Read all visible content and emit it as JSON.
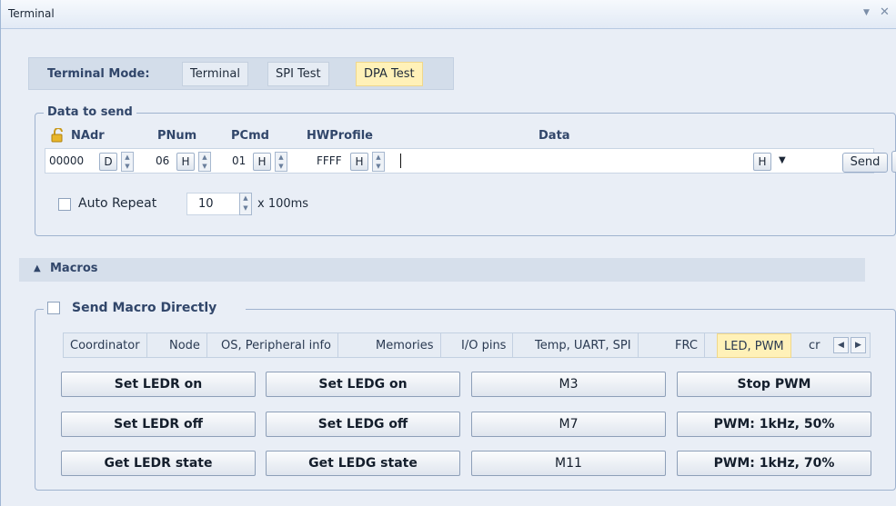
{
  "window": {
    "title": "Terminal",
    "pin_glyph": "▼",
    "close_glyph": "✕"
  },
  "mode": {
    "label": "Terminal Mode:",
    "buttons": [
      {
        "label": "Terminal",
        "active": false
      },
      {
        "label": "SPI Test",
        "active": false
      },
      {
        "label": "DPA Test",
        "active": true
      }
    ]
  },
  "send": {
    "legend": "Data to send",
    "headers": {
      "nadr": "NAdr",
      "pnum": "PNum",
      "pcmd": "PCmd",
      "hwprofile": "HWProfile",
      "data": "Data"
    },
    "nadr": {
      "value": "00000",
      "format": "D"
    },
    "pnum": {
      "value": "06",
      "format": "H"
    },
    "pcmd": {
      "value": "01",
      "format": "H"
    },
    "hwprofile": {
      "value": "FFFF",
      "format": "H"
    },
    "data": {
      "value": "",
      "format": "H"
    },
    "send_label": "Send",
    "auto_repeat_label": "Auto Repeat",
    "auto_repeat_value": "10",
    "auto_repeat_unit": "x 100ms",
    "icons": {
      "lock": "lock-open-icon",
      "clear": "clear-icon"
    }
  },
  "macros": {
    "section_label": "Macros",
    "direct_label": "Send Macro Directly",
    "tabs": [
      {
        "label": "Coordinator",
        "active": false
      },
      {
        "label": "Node",
        "active": false
      },
      {
        "label": "OS, Peripheral info",
        "active": false
      },
      {
        "label": "Memories",
        "active": false
      },
      {
        "label": "I/O pins",
        "active": false
      },
      {
        "label": "Temp, UART, SPI",
        "active": false
      },
      {
        "label": "FRC",
        "active": false
      },
      {
        "label": "LED, PWM",
        "active": true
      },
      {
        "label": "cr",
        "active": false
      }
    ],
    "buttons": [
      [
        "Set LEDR on",
        "Set LEDG on",
        "M3",
        "Stop PWM"
      ],
      [
        "Set LEDR off",
        "Set LEDG off",
        "M7",
        "PWM: 1kHz, 50%"
      ],
      [
        "Get LEDR state",
        "Get LEDG state",
        "M11",
        "PWM: 1kHz, 70%"
      ]
    ]
  },
  "colors": {
    "accent_active": "#fff1b8",
    "section_text": "#31466a",
    "clear_red": "#d92c12"
  }
}
